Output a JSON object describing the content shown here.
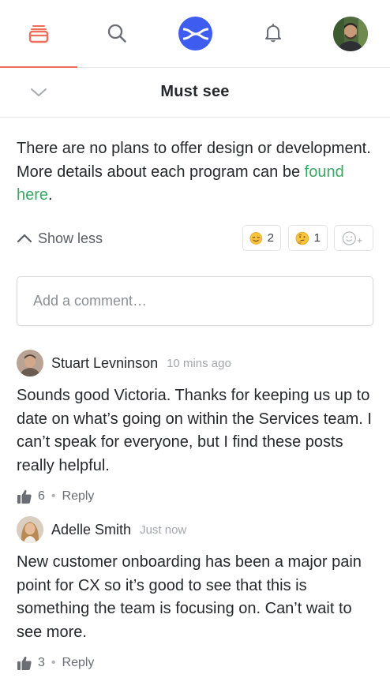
{
  "nav": {
    "items": [
      {
        "icon": "feed-stack-icon"
      },
      {
        "icon": "search-icon"
      },
      {
        "icon": "cx-logo-icon"
      },
      {
        "icon": "bell-icon"
      },
      {
        "icon": "profile-avatar"
      }
    ],
    "active_color": "#f06d5b",
    "brand_color": "#3e5df0"
  },
  "header": {
    "title": "Must see",
    "collapse_icon": "chevron-down-icon"
  },
  "post": {
    "text_before_link": "There are no plans to offer design or development. More details about each program can be ",
    "link_text": "found here",
    "text_after_link": ".",
    "link_color": "#3aa765",
    "show_less_label": "Show less",
    "reactions": [
      {
        "emoji": "relieved-face-icon",
        "count": "2"
      },
      {
        "emoji": "thinking-face-icon",
        "count": "1"
      }
    ],
    "add_reaction_icon": "add-reaction-icon"
  },
  "comment_input": {
    "placeholder": "Add a comment…"
  },
  "comments": [
    {
      "author": "Stuart Levninson",
      "time": "10 mins ago",
      "text": "Sounds good Victoria. Thanks for keeping us up to date on what’s going on within the Services team. I can’t speak for everyone, but I find these posts really helpful.",
      "likes": "6",
      "dot": "•",
      "reply_label": "Reply"
    },
    {
      "author": "Adelle Smith",
      "time": "Just now",
      "text": "New customer onboarding has been a major pain point for CX so it’s good to see that this is something the team is focusing on. Can’t wait to see more.",
      "likes": "3",
      "dot": "•",
      "reply_label": "Reply"
    }
  ]
}
